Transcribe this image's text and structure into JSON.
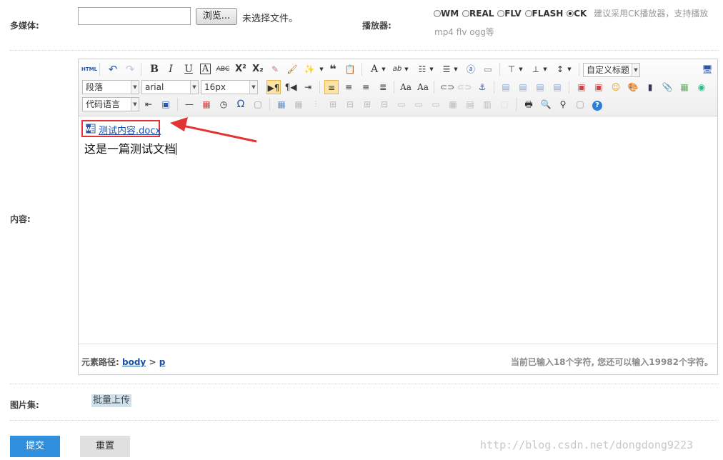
{
  "media": {
    "label": "多媒体:",
    "browse_label": "浏览...",
    "no_file_text": "未选择文件。",
    "file_value": ""
  },
  "player": {
    "label": "播放器:",
    "options": [
      {
        "label": "WM",
        "checked": false
      },
      {
        "label": "REAL",
        "checked": false
      },
      {
        "label": "FLV",
        "checked": false
      },
      {
        "label": "FLASH",
        "checked": false
      },
      {
        "label": "CK",
        "checked": true
      }
    ],
    "hint_line1": "建议采用CK播放器，支持播放",
    "hint_line2": "mp4 flv ogg等"
  },
  "content": {
    "label": "内容:",
    "toolbar": {
      "html_label": "HTML",
      "custom_heading": "自定义标题",
      "paragraph_format": "段落",
      "font_family": "arial",
      "font_size": "16px",
      "code_language": "代码语言"
    },
    "attachment_name": "测试内容.docx",
    "body_text": "这是一篇测试文档",
    "path_label": "元素路径:",
    "path_body": "body",
    "path_sep": ">",
    "path_p": "p",
    "char_count": "当前已输入18个字符, 您还可以输入19982个字符。"
  },
  "gallery": {
    "label": "图片集:",
    "batch_upload": "批量上传"
  },
  "actions": {
    "submit": "提交",
    "reset": "重置"
  },
  "watermark": "http://blog.csdn.net/dongdong9223",
  "colors": {
    "accent": "#2f8fdc",
    "highlight_box": "#e23434",
    "link": "#1a4ea8"
  }
}
